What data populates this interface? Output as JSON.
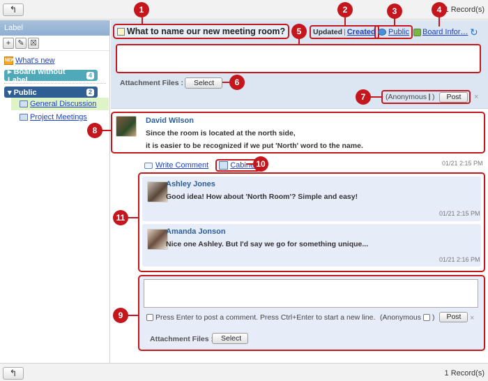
{
  "toolbar": {
    "back_icon": "back-arrow-icon",
    "back_glyph": "↰",
    "records": "1 Record(s)"
  },
  "left_panel": {
    "header": "Label",
    "tools": [
      "+",
      "✎",
      "☒"
    ],
    "whats_new": "What's new",
    "whats_new_icon_text": "NEW",
    "board_without_label": {
      "label": "Board without Label",
      "count": "4"
    },
    "public": {
      "label": "Public",
      "count": "2"
    },
    "rooms": [
      "General Discussion",
      "Project Meetings"
    ]
  },
  "room": {
    "title": "What to name our new meeting room?",
    "updated": "Updated",
    "created": "Created",
    "public_link": "Public",
    "board_info": "Board Infor…",
    "refresh_glyph": "↻",
    "attachment_label": "Attachment Files :",
    "select_button": "Select",
    "anonymous_label": "(Anonymous",
    "anonymous_close": ")",
    "post_button": "Post",
    "close_glyph": "×"
  },
  "comment": {
    "author": "David Wilson",
    "line1": "Since the room is located at the north side,",
    "line2": "it is easier to be recognized if we put 'North' word to the name.",
    "write_comment": "Write Comment",
    "cabinet": "Cabinet",
    "timestamp": "01/21  2:15 PM"
  },
  "replies": [
    {
      "author": "Ashley Jones",
      "text": "Good idea! How about 'North Room'? Simple and easy!",
      "timestamp": "01/21  2:15 PM"
    },
    {
      "author": "Amanda Jonson",
      "text": "Nice one Ashley. But I'd say we go for something unique...",
      "timestamp": "01/21  2:16 PM"
    }
  ],
  "write_box": {
    "hint": "Press Enter to post a comment. Press Ctrl+Enter to start a new line.",
    "anonymous_label": "(Anonymous",
    "anonymous_close": ")",
    "post_button": "Post",
    "attachment_label": "Attachment Files :",
    "select_button": "Select",
    "close_glyph": "×"
  },
  "callouts": [
    "1",
    "2",
    "3",
    "4",
    "5",
    "6",
    "7",
    "8",
    "9",
    "10",
    "11"
  ],
  "colors": {
    "callout_red": "#c4171d",
    "link_blue": "#1a3fc4",
    "header_blue": "#dbe6f2",
    "reply_bg": "#e7ecf9"
  }
}
